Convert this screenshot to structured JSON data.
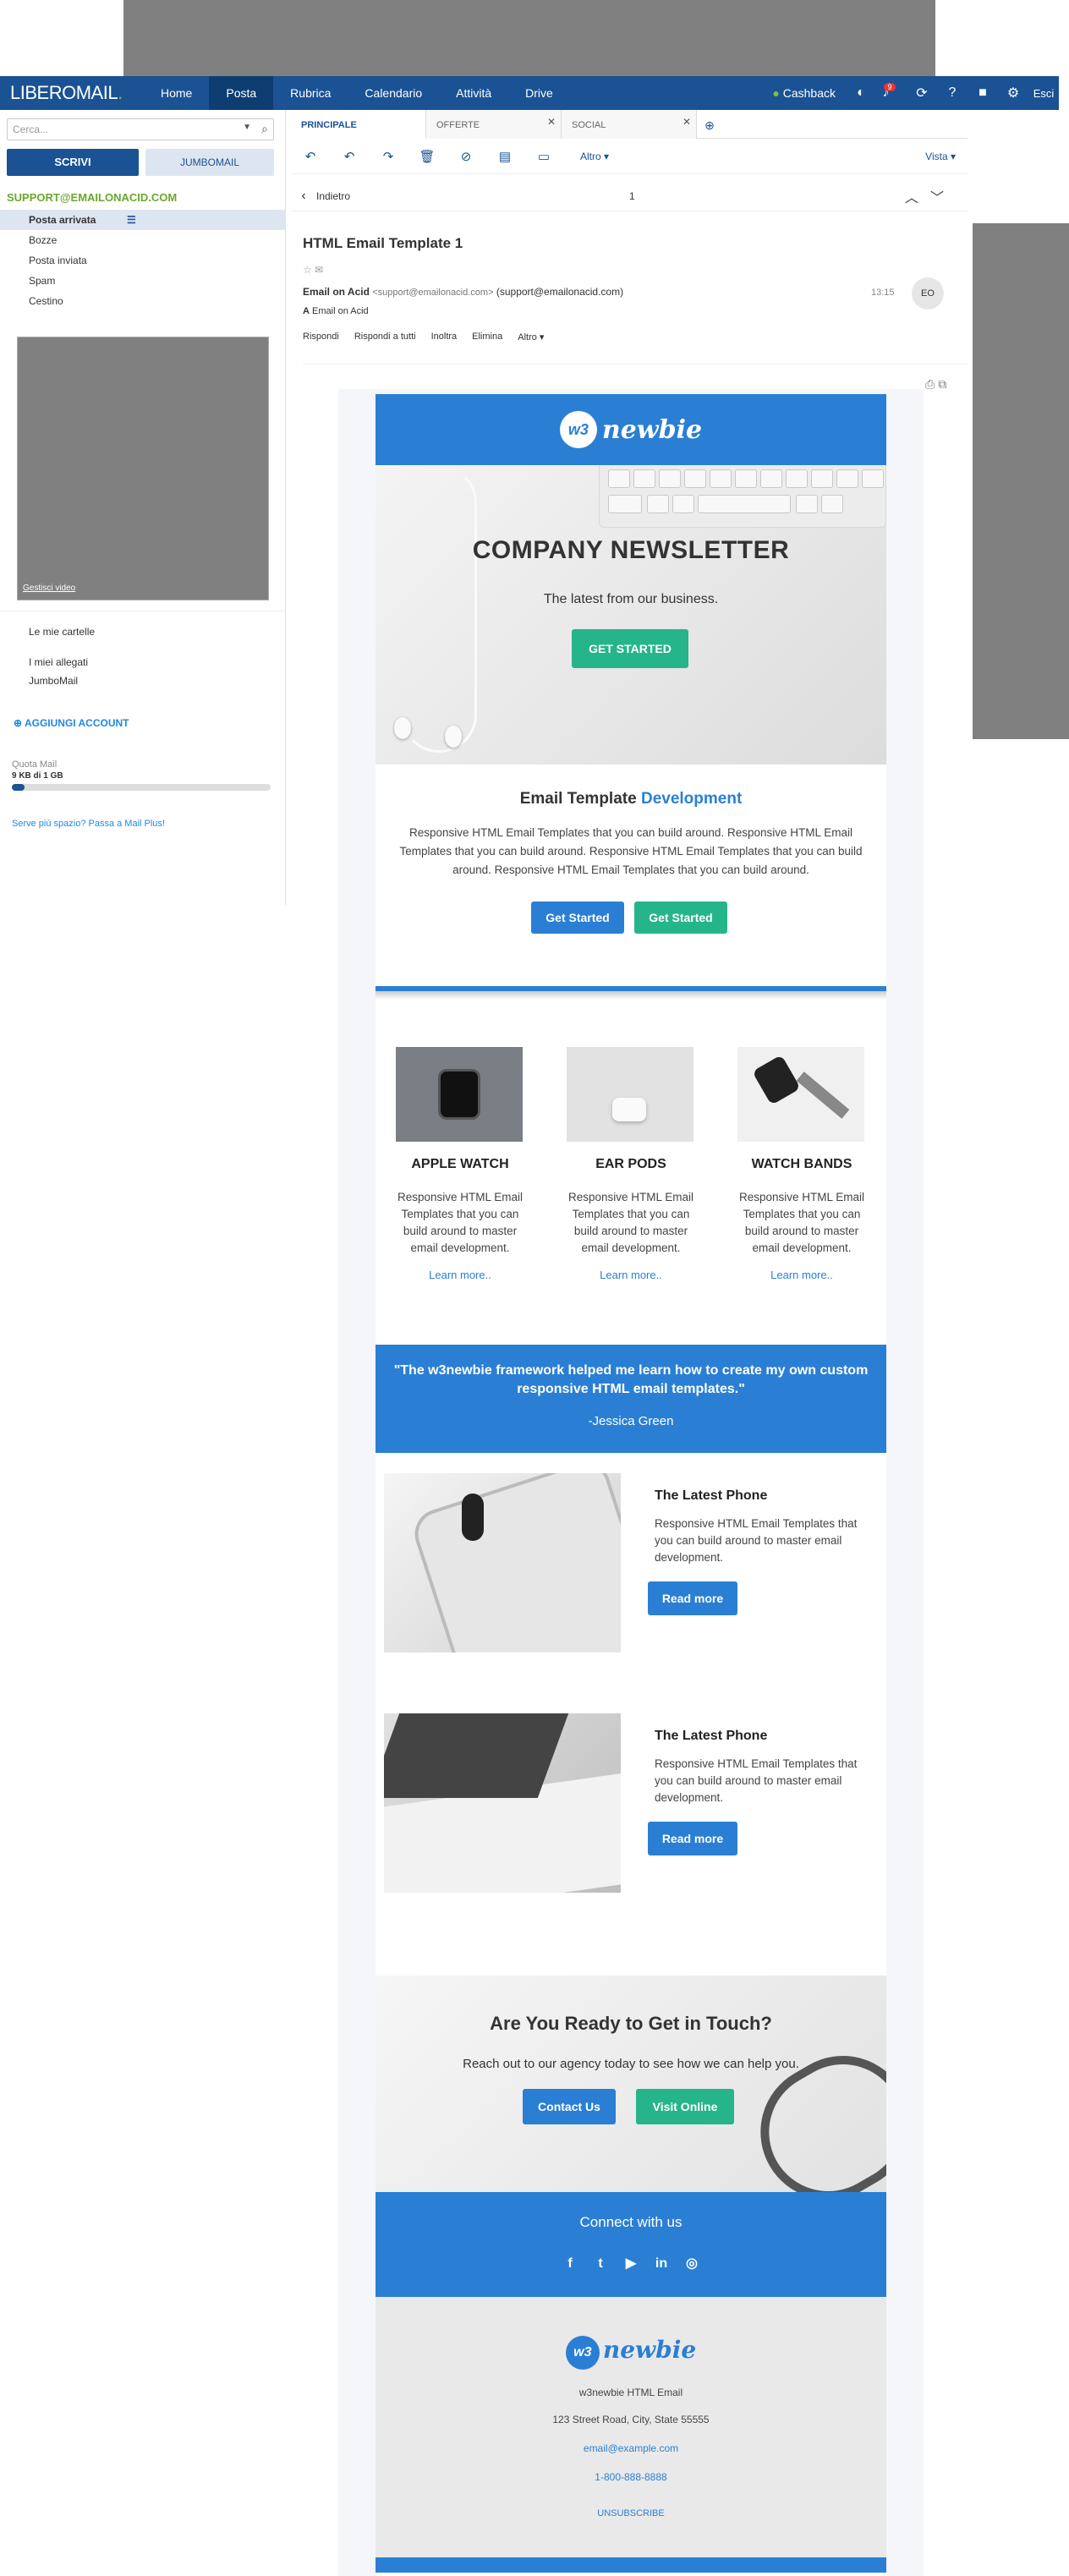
{
  "nav": {
    "logo_prefix": "LIBERO",
    "logo_suffix": "MAIL",
    "logo_dot": ".",
    "items": [
      "Home",
      "Posta",
      "Rubrica",
      "Calendario",
      "Attività",
      "Drive"
    ],
    "active": "Posta",
    "cashback": "Cashback",
    "notifications_count": "9",
    "logout": "Esci"
  },
  "sidebar": {
    "search_placeholder": "Cerca...",
    "write_button": "SCRIVI",
    "jumbo_button": "JUMBOMAIL",
    "account": "SUPPORT@EMAILONACID.COM",
    "folders": [
      "Posta arrivata",
      "Bozze",
      "Posta inviata",
      "Spam",
      "Cestino"
    ],
    "video_link": "Gestisci video",
    "links": [
      "Le mie cartelle",
      "I miei allegati",
      "JumboMail"
    ],
    "add_account": "AGGIUNGI ACCOUNT",
    "quota_label": "Quota Mail",
    "quota_value": "9 KB di 1 GB",
    "quota_fraction": 0.05,
    "upgrade": "Serve più spazio? Passa a Mail Plus!"
  },
  "tabs": {
    "items": [
      "PRINCIPALE",
      "OFFERTE",
      "SOCIAL"
    ]
  },
  "toolbar": {
    "altro": "Altro",
    "vista": "Vista"
  },
  "backbar": {
    "back": "Indietro",
    "page": "1"
  },
  "message": {
    "subject": "HTML Email Template 1",
    "from_name": "Email on Acid",
    "from_email": "<support@emailonacid.com>",
    "from_email2": "(support@emailonacid.com)",
    "time": "13:15",
    "avatar": "EO",
    "to_label": "A",
    "to": "Email on Acid",
    "actions": [
      "Rispondi",
      "Rispondi a tutti",
      "Inoltra",
      "Elimina",
      "Altro"
    ]
  },
  "email": {
    "logo_mark": "w3",
    "logo_text": "newbie",
    "hero_title": "COMPANY NEWSLETTER",
    "hero_sub": "The latest from our business.",
    "hero_button": "GET STARTED",
    "intro_title_a": "Email Template",
    "intro_title_b": "Development",
    "intro_text": "Responsive HTML Email Templates that you can build around. Responsive HTML Email Templates that you can build around. Responsive HTML Email Templates that you can build around. Responsive HTML Email Templates that you can build around.",
    "intro_btn1": "Get Started",
    "intro_btn2": "Get Started",
    "products": [
      {
        "title": "APPLE WATCH",
        "text": "Responsive HTML Email Templates that you can build around to master email development.",
        "link": "Learn more.."
      },
      {
        "title": "EAR PODS",
        "text": "Responsive HTML Email Templates that you can build around to master email development.",
        "link": "Learn more.."
      },
      {
        "title": "WATCH BANDS",
        "text": "Responsive HTML Email Templates that you can build around to master email development.",
        "link": "Learn more.."
      }
    ],
    "quote": "\"The w3newbie framework helped me learn how to create my own custom responsive HTML email templates.\"",
    "quote_author": "-Jessica Green",
    "phones": [
      {
        "title": "The Latest Phone",
        "text": "Responsive HTML Email Templates that you can build around to master email development.",
        "button": "Read more"
      },
      {
        "title": "The Latest Phone",
        "text": "Responsive HTML Email Templates that you can build around to master email development.",
        "button": "Read more"
      }
    ],
    "cta_title": "Are You Ready to Get in Touch?",
    "cta_sub": "Reach out to our agency today to see how we can help you.",
    "cta_btn1": "Contact Us",
    "cta_btn2": "Visit Online",
    "connect": "Connect with us",
    "social": [
      "f",
      "t",
      "▶",
      "in",
      "◎"
    ],
    "footer_name": "w3newbie HTML Email",
    "footer_address": "123 Street Road, City, State 55555",
    "footer_email": "email@example.com",
    "footer_phone": "1-800-888-8888",
    "unsubscribe": "UNSUBSCRIBE"
  }
}
